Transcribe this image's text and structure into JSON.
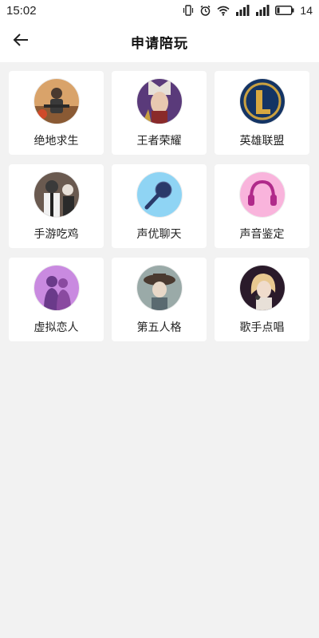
{
  "status_bar": {
    "time": "15:02",
    "battery": "14",
    "icons": [
      "vibrate-icon",
      "alarm-icon",
      "wifi-icon",
      "signal-3g-icon",
      "signal-4g-icon",
      "battery-icon"
    ]
  },
  "header": {
    "back_icon": "arrow-left-icon",
    "title": "申请陪玩"
  },
  "categories": [
    {
      "label": "绝地求生",
      "icon": "pubg-avatar",
      "color": "#c98a4a"
    },
    {
      "label": "王者荣耀",
      "icon": "honor-of-kings-avatar",
      "color": "#7a4a8a"
    },
    {
      "label": "英雄联盟",
      "icon": "lol-avatar",
      "color": "#1c3f72"
    },
    {
      "label": "手游吃鸡",
      "icon": "mobile-pubg-avatar",
      "color": "#5a4a40"
    },
    {
      "label": "声优聊天",
      "icon": "microphone-avatar",
      "color": "#5fb8e8"
    },
    {
      "label": "声音鉴定",
      "icon": "headphones-avatar",
      "color": "#f08ac8"
    },
    {
      "label": "虚拟恋人",
      "icon": "couple-avatar",
      "color": "#b070d0"
    },
    {
      "label": "第五人格",
      "icon": "identity-v-avatar",
      "color": "#7a8a8a"
    },
    {
      "label": "歌手点唱",
      "icon": "singer-avatar",
      "color": "#3a2a3a"
    }
  ]
}
